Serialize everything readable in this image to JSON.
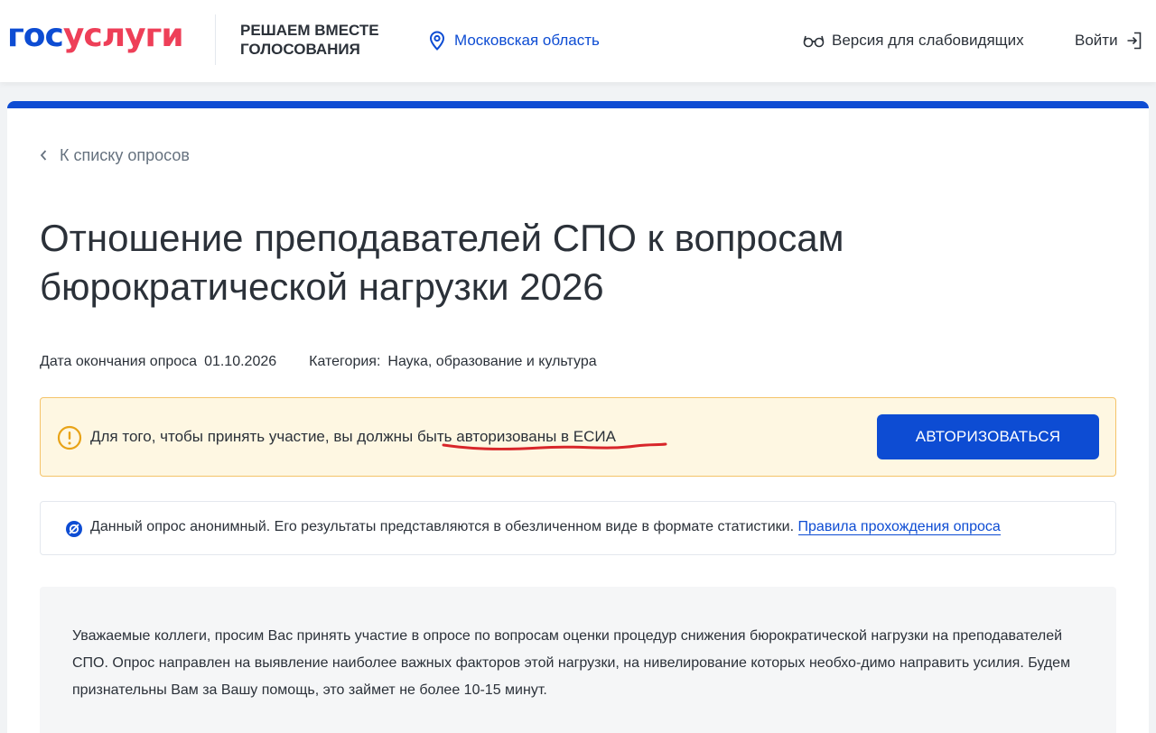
{
  "header": {
    "logo_part1": "гос",
    "logo_part2": "услуги",
    "project_name": "РЕШАЕМ ВМЕСТЕ ГОЛОСОВАНИЯ",
    "region": "Московская область",
    "a11y_label": "Версия для слабовидящих",
    "login_label": "Войти",
    "icons": {
      "region": "location-pin-icon",
      "a11y": "glasses-icon",
      "login": "login-arrow-icon"
    }
  },
  "back_link": {
    "label": "К списку опросов",
    "icon": "chevron-left-icon"
  },
  "survey": {
    "title": "Отношение преподавателей СПО к вопросам бюрократической нагрузки 2026",
    "end_date_label": "Дата окончания опроса",
    "end_date": "01.10.2026",
    "category_label": "Категория:",
    "category": "Наука, образование и культура"
  },
  "warning": {
    "text_before": "Для того, чтобы принять участие, вы должны ",
    "text_marked": "быть авторизованы в ЕСИА",
    "button_label": "АВТОРИЗОВАТЬСЯ",
    "icon": "exclamation-circle-icon"
  },
  "info": {
    "text": "Данный опрос анонимный. Его результаты представляются в обезличенном виде в формате статистики.",
    "link_label": "Правила прохождения опроса",
    "icon": "anonymous-icon"
  },
  "description": {
    "text": "Уважаемые коллеги, просим Вас принять участие в опросе по вопросам оценки процедур снижения бюрократической нагрузки на преподавателей СПО. Опрос направлен на выявление наиболее важных факторов этой нагрузки, на нивелирование которых необхо-димо направить усилия. Будем признательны Вам за Вашу помощь, это займет не более 10-15 минут."
  },
  "colors": {
    "brand_blue": "#0d4cd3",
    "brand_red": "#ee3f58",
    "warning_bg": "#fef7e2",
    "warning_border": "#f4c36a",
    "annotation_red": "#d8262a"
  }
}
